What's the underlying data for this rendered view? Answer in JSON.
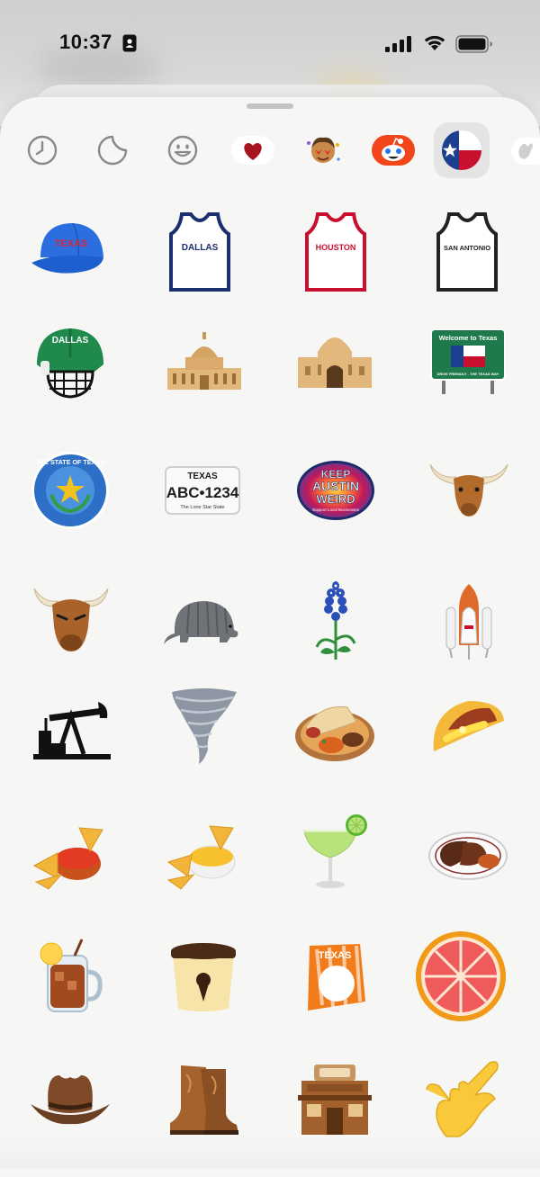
{
  "status_bar": {
    "time": "10:37",
    "icons": [
      "id-card-icon",
      "cellular-signal-icon",
      "wifi-icon",
      "battery-icon"
    ]
  },
  "category_bar": {
    "items": [
      {
        "name": "recent",
        "icon": "clock-icon",
        "selected": false
      },
      {
        "name": "stickers",
        "icon": "sticker-icon",
        "selected": false
      },
      {
        "name": "emoji",
        "icon": "smiley-icon",
        "selected": false
      },
      {
        "name": "heart-stickers",
        "icon": "red-heart-icon",
        "selected": false
      },
      {
        "name": "memoji",
        "icon": "memoji-face-icon",
        "selected": false
      },
      {
        "name": "app-stickers",
        "icon": "alien-mascot-icon",
        "selected": false
      },
      {
        "name": "texas-pack",
        "icon": "texas-flag-icon",
        "selected": true
      },
      {
        "name": "more",
        "icon": "hand-sticker-icon",
        "selected": false
      }
    ]
  },
  "stickers": {
    "cap_text": "TEXAS",
    "jersey_1_text": "DALLAS",
    "jersey_2_text": "HOUSTON",
    "jersey_3_text": "SAN ANTONIO",
    "helmet_text": "DALLAS",
    "welcome_sign_title": "Welcome to Texas",
    "welcome_sign_sub": "DRIVE FRIENDLY - THE TEXAS WAY",
    "seal_text": "THE STATE OF TEXAS",
    "plate_state": "TEXAS",
    "plate_number": "ABC•1234",
    "plate_sub": "The Lone Star State",
    "keep_austin_l1": "KEEP",
    "keep_austin_l2": "AUSTIN",
    "keep_austin_l3": "WEIRD",
    "keep_austin_sub": "Support Local Businesses",
    "whataburger_text": "TEXAS",
    "items": [
      "blue-texas-cap",
      "dallas-jersey",
      "houston-jersey",
      "san-antonio-jersey",
      "dallas-hockey-helmet",
      "texas-capitol",
      "alamo",
      "welcome-to-texas-sign",
      "state-of-texas-seal",
      "texas-license-plate",
      "keep-austin-weird-badge",
      "longhorn-head",
      "bull-head",
      "armadillo",
      "bluebonnet",
      "space-shuttle",
      "oil-pump",
      "tornado",
      "burrito-plate",
      "taco",
      "chips-and-salsa",
      "chips-and-queso",
      "margarita",
      "brisket-plate",
      "iced-tea-jar",
      "ice-cream-pint",
      "whataburger-tent",
      "grapefruit",
      "cowboy-hat",
      "cowboy-boots",
      "saloon",
      "hook-em-hand"
    ]
  }
}
